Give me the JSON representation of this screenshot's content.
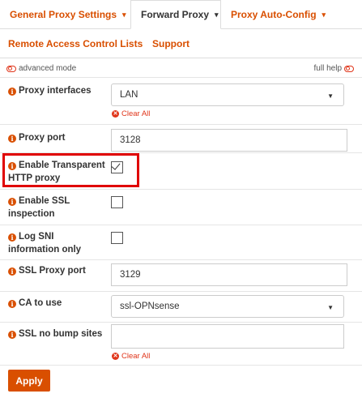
{
  "tabs": {
    "row1": [
      {
        "label": "General Proxy Settings",
        "caret": "▾",
        "active": false
      },
      {
        "label": "Forward Proxy",
        "caret": "▾",
        "active": true
      },
      {
        "label": "Proxy Auto-Config",
        "caret": "▾",
        "active": false
      }
    ],
    "row2": [
      {
        "label": "Remote Access Control Lists"
      },
      {
        "label": "Support"
      }
    ]
  },
  "advanced_mode": {
    "label": "advanced mode"
  },
  "full_help": {
    "label": "full help"
  },
  "fields": {
    "proxy_interfaces": {
      "label": "Proxy interfaces",
      "value": "LAN",
      "clear": "Clear All"
    },
    "proxy_port": {
      "label": "Proxy port",
      "value": "3128"
    },
    "transparent": {
      "label": "Enable Transparent HTTP proxy",
      "checked": true
    },
    "ssl_inspection": {
      "label": "Enable SSL inspection",
      "checked": false
    },
    "log_sni": {
      "label": "Log SNI information only",
      "checked": false
    },
    "ssl_port": {
      "label": "SSL Proxy port",
      "value": "3129"
    },
    "ca": {
      "label": "CA to use",
      "value": "ssl-OPNsense"
    },
    "no_bump": {
      "label": "SSL no bump sites",
      "value": "",
      "clear": "Clear All"
    }
  },
  "apply": {
    "label": "Apply"
  },
  "colors": {
    "accent": "#d94f00",
    "danger": "#e0351a",
    "highlight": "#e00000"
  },
  "icons": {
    "info": "info-icon",
    "toggle": "toggle-off-icon",
    "clear": "remove-circle-icon",
    "dropdown": "caret-down-icon"
  }
}
